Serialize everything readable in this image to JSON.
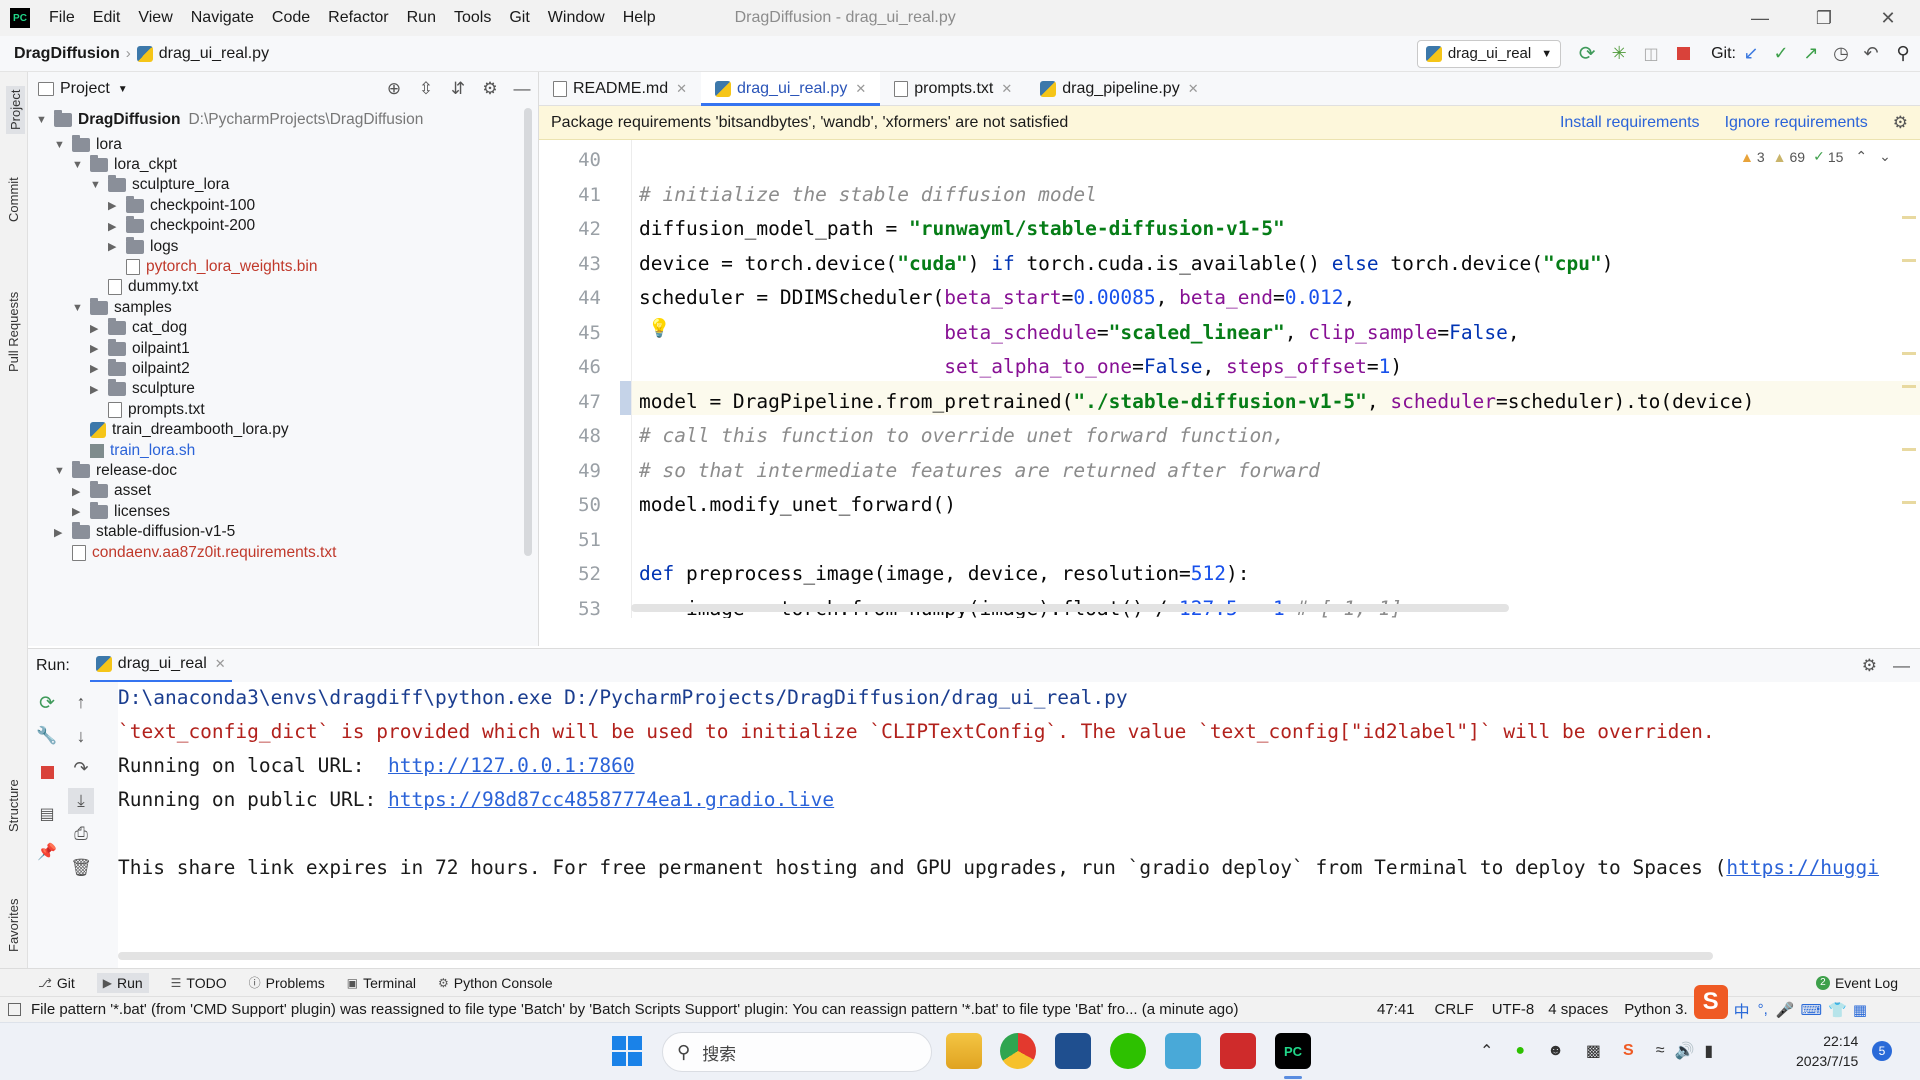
{
  "menu": [
    "File",
    "Edit",
    "View",
    "Navigate",
    "Code",
    "Refactor",
    "Run",
    "Tools",
    "Git",
    "Window",
    "Help"
  ],
  "window_title": "DragDiffusion - drag_ui_real.py",
  "breadcrumb": {
    "project": "DragDiffusion",
    "file": "drag_ui_real.py"
  },
  "run_config": "drag_ui_real",
  "git_label": "Git:",
  "left_strip": [
    "Project",
    "Commit",
    "Pull Requests",
    "Structure",
    "Favorites"
  ],
  "project_panel": {
    "title": "Project",
    "root": {
      "name": "DragDiffusion",
      "path": "D:\\PycharmProjects\\DragDiffusion"
    },
    "items": [
      {
        "label": "lora",
        "type": "folder",
        "depth": 1,
        "open": true
      },
      {
        "label": "lora_ckpt",
        "type": "folder",
        "depth": 2,
        "open": true
      },
      {
        "label": "sculpture_lora",
        "type": "folder",
        "depth": 3,
        "open": true
      },
      {
        "label": "checkpoint-100",
        "type": "folder",
        "depth": 4,
        "open": false
      },
      {
        "label": "checkpoint-200",
        "type": "folder",
        "depth": 4,
        "open": false
      },
      {
        "label": "logs",
        "type": "folder",
        "depth": 4,
        "open": false
      },
      {
        "label": "pytorch_lora_weights.bin",
        "type": "file-red",
        "depth": 4
      },
      {
        "label": "dummy.txt",
        "type": "file",
        "depth": 3
      },
      {
        "label": "samples",
        "type": "folder",
        "depth": 2,
        "open": true
      },
      {
        "label": "cat_dog",
        "type": "folder",
        "depth": 3,
        "open": false
      },
      {
        "label": "oilpaint1",
        "type": "folder",
        "depth": 3,
        "open": false
      },
      {
        "label": "oilpaint2",
        "type": "folder",
        "depth": 3,
        "open": false
      },
      {
        "label": "sculpture",
        "type": "folder",
        "depth": 3,
        "open": false
      },
      {
        "label": "prompts.txt",
        "type": "file",
        "depth": 3
      },
      {
        "label": "train_dreambooth_lora.py",
        "type": "py",
        "depth": 2
      },
      {
        "label": "train_lora.sh",
        "type": "sh",
        "depth": 2
      },
      {
        "label": "release-doc",
        "type": "folder",
        "depth": 1,
        "open": true
      },
      {
        "label": "asset",
        "type": "folder",
        "depth": 2,
        "open": false
      },
      {
        "label": "licenses",
        "type": "folder",
        "depth": 2,
        "open": false
      },
      {
        "label": "stable-diffusion-v1-5",
        "type": "folder",
        "depth": 1,
        "open": false
      },
      {
        "label": "condaenv.aa87z0it.requirements.txt",
        "type": "file-red",
        "depth": 1
      }
    ]
  },
  "tabs": [
    {
      "label": "README.md",
      "icon": "markdown-icon",
      "active": false
    },
    {
      "label": "drag_ui_real.py",
      "icon": "python-icon",
      "active": true
    },
    {
      "label": "prompts.txt",
      "icon": "text-file-icon",
      "active": false
    },
    {
      "label": "drag_pipeline.py",
      "icon": "python-icon",
      "active": false
    }
  ],
  "banner": {
    "message": "Package requirements 'bitsandbytes', 'wandb', 'xformers' are not satisfied",
    "install": "Install requirements",
    "ignore": "Ignore requirements"
  },
  "inspections": {
    "warnings": "3",
    "weak_warnings": "69",
    "typos": "15"
  },
  "code_lines": [
    {
      "n": "40",
      "html": ""
    },
    {
      "n": "41",
      "html": "<span class=\"cmt\"># initialize the stable diffusion model</span>"
    },
    {
      "n": "42",
      "html": "diffusion_model_path = <span class=\"str\">\"runwayml/stable-diffusion-v1-5\"</span>"
    },
    {
      "n": "43",
      "html": "device = torch.device(<span class=\"str\">\"cuda\"</span>) <span class=\"kw\">if</span> torch.cuda.is_available() <span class=\"kw\">else</span> torch.device(<span class=\"str\">\"cpu\"</span>)"
    },
    {
      "n": "44",
      "html": "scheduler = DDIMScheduler(<span class=\"prm\">beta_start</span>=<span class=\"num\">0.00085</span>, <span class=\"prm\">beta_end</span>=<span class=\"num\">0.012</span>,"
    },
    {
      "n": "45",
      "html": "                          <span class=\"prm\">beta_schedule</span>=<span class=\"str\">\"scaled_linear\"</span>, <span class=\"prm\">clip_sample</span>=<span class=\"kw\">False</span>,"
    },
    {
      "n": "46",
      "html": "                          <span class=\"prm\">set_alpha_to_one</span>=<span class=\"kw\">False</span>, <span class=\"prm\">steps_offset</span>=<span class=\"num\">1</span>)"
    },
    {
      "n": "47",
      "html": "model = DragPipeline.from_pretrained(<span class=\"str\">\"./stable-diffusion-v1-5\"</span>, <span class=\"prm\">scheduler</span>=scheduler).to(device)"
    },
    {
      "n": "48",
      "html": "<span class=\"cmt\"># call this function to override unet forward function,</span>"
    },
    {
      "n": "49",
      "html": "<span class=\"cmt\"># so that intermediate features are returned after forward</span>"
    },
    {
      "n": "50",
      "html": "model.modify_unet_forward()"
    },
    {
      "n": "51",
      "html": ""
    },
    {
      "n": "52",
      "html": "<span class=\"kw\">def</span> preprocess_image(image, device, resolution=<span class=\"num\">512</span>):"
    },
    {
      "n": "53",
      "html": "    image = torch.from_numpy(image).float() / <span class=\"num\">127.5</span> - <span class=\"num\">1</span> <span class=\"cmt\"># [-1, 1]</span>"
    }
  ],
  "run_panel": {
    "label": "Run:",
    "tab": "drag_ui_real",
    "lines": [
      {
        "cls": "blue",
        "text": "D:\\anaconda3\\envs\\dragdiff\\python.exe D:/PycharmProjects/DragDiffusion/drag_ui_real.py"
      },
      {
        "cls": "red",
        "text": "`text_config_dict` is provided which will be used to initialize `CLIPTextConfig`. The value `text_config[\"id2label\"]` will be overriden."
      },
      {
        "cls": "",
        "text": "Running on local URL:  ",
        "link": "http://127.0.0.1:7860"
      },
      {
        "cls": "",
        "text": "Running on public URL: ",
        "link": "https://98d87cc48587774ea1.gradio.live"
      },
      {
        "cls": "",
        "text": ""
      },
      {
        "cls": "",
        "text": "This share link expires in 72 hours. For free permanent hosting and GPU upgrades, run `gradio deploy` from Terminal to deploy to Spaces (",
        "link": "https://huggi"
      }
    ]
  },
  "tool_windows": [
    "Git",
    "Run",
    "TODO",
    "Problems",
    "Terminal",
    "Python Console"
  ],
  "event_log": "Event Log",
  "status": {
    "message": "File pattern '*.bat' (from 'CMD Support' plugin) was reassigned to file type 'Batch' by 'Batch Scripts Support' plugin: You can reassign pattern '*.bat' to file type 'Bat' fro... (a minute ago)",
    "position": "47:41",
    "line_sep": "CRLF",
    "encoding": "UTF-8",
    "indent": "4 spaces",
    "interpreter": "Python 3."
  },
  "taskbar": {
    "search_placeholder": "搜索",
    "time": "22:14",
    "date": "2023/7/15",
    "badge": "5",
    "ime": "中"
  },
  "colors": {
    "accent": "#3574f0",
    "string": "#067d17",
    "keyword": "#0033b3",
    "number": "#1750eb",
    "param": "#871094"
  }
}
